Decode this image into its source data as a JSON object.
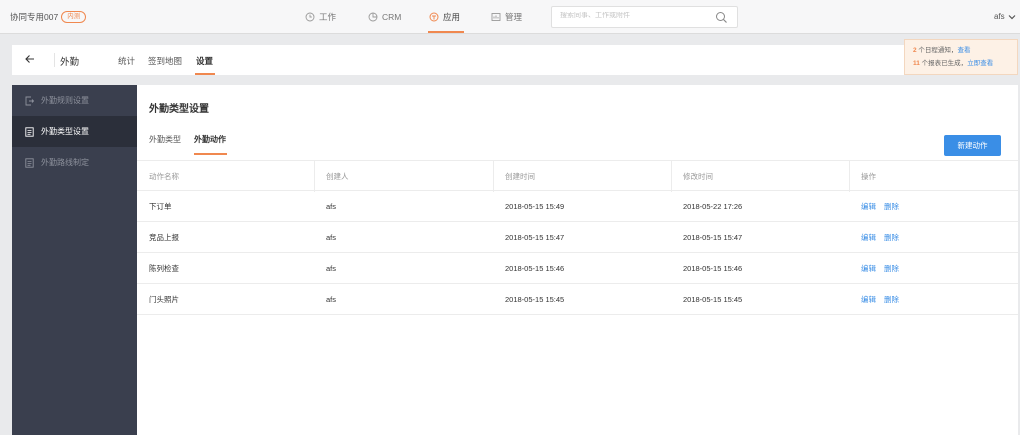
{
  "topbar": {
    "brand": "协同专用007",
    "brand_badge": "内测",
    "nav": [
      {
        "label": "工作",
        "icon": "clock-icon"
      },
      {
        "label": "CRM",
        "icon": "pie-chart-icon"
      },
      {
        "label": "应用",
        "icon": "box-icon",
        "active": true
      },
      {
        "label": "管理",
        "icon": "manage-icon"
      }
    ],
    "search_placeholder": "搜索同事、工作或附件",
    "user": "afs"
  },
  "subheader": {
    "title": "外勤",
    "nav": [
      "统计",
      "签到地图",
      "设置"
    ]
  },
  "notification": {
    "line1_count": "2",
    "line1_text": " 个日程通知，",
    "line1_link": "查看",
    "line2_count": "11",
    "line2_text": " 个报表已生成，",
    "line2_link": "立即查看"
  },
  "sidebar": {
    "items": [
      {
        "label": "外勤规则设置"
      },
      {
        "label": "外勤类型设置",
        "active": true
      },
      {
        "label": "外勤路线制定"
      }
    ]
  },
  "main": {
    "title": "外勤类型设置",
    "tabs": [
      "外勤类型",
      "外勤动作"
    ],
    "new_button": "新建动作",
    "columns": [
      "动作名称",
      "创建人",
      "创建时间",
      "修改时间",
      "操作"
    ],
    "rows": [
      {
        "name": "下订单",
        "creator": "afs",
        "created": "2018-05-15 15:49",
        "modified": "2018-05-22 17:26"
      },
      {
        "name": "竞品上报",
        "creator": "afs",
        "created": "2018-05-15 15:47",
        "modified": "2018-05-15 15:47"
      },
      {
        "name": "陈列检查",
        "creator": "afs",
        "created": "2018-05-15 15:46",
        "modified": "2018-05-15 15:46"
      },
      {
        "name": "门头照片",
        "creator": "afs",
        "created": "2018-05-15 15:45",
        "modified": "2018-05-15 15:45"
      }
    ],
    "actions": [
      "编辑",
      "删除"
    ]
  },
  "colors": {
    "accent": "#f0884f",
    "link": "#3a8ee6",
    "sidebar_bg": "#3a3f4e",
    "sidebar_active": "#2b2f3a"
  }
}
